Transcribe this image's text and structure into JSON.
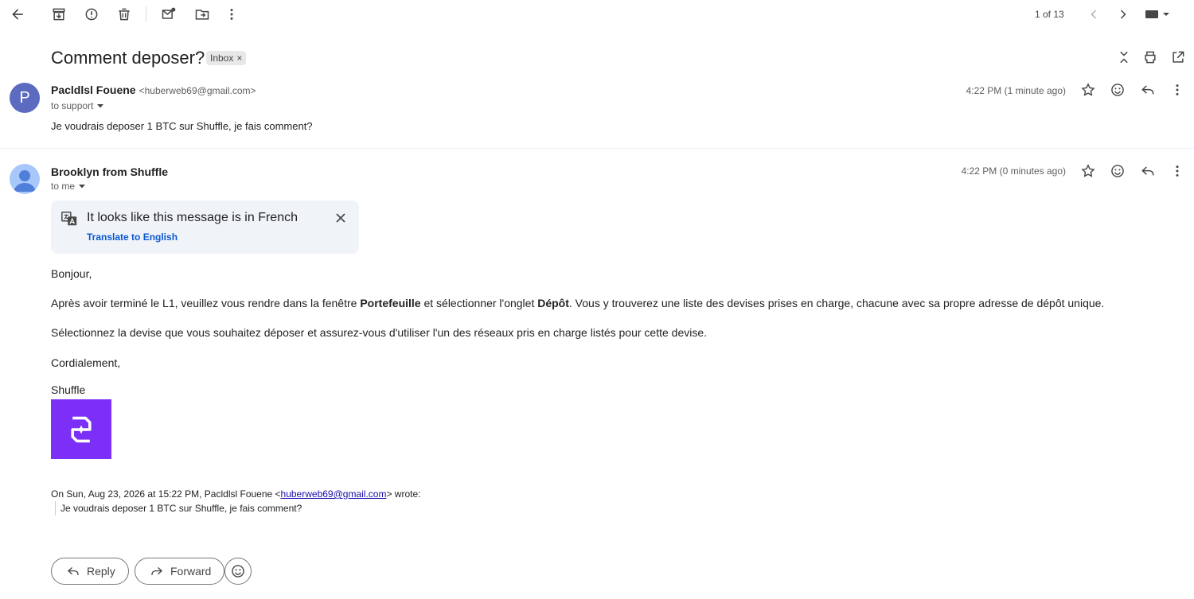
{
  "toolbar": {
    "pagination": "1 of 13"
  },
  "subject": {
    "title": "Comment deposer?",
    "label": "Inbox",
    "label_remove": "×"
  },
  "message1": {
    "avatar_letter": "P",
    "avatar_color": "#5c6bc0",
    "sender_name": "Pacldlsl Fouene",
    "sender_email": "<huberweb69@gmail.com>",
    "to": "to support",
    "time": "4:22 PM (1 minute ago)",
    "body": "Je voudrais deposer 1 BTC sur Shuffle, je fais comment?"
  },
  "message2": {
    "sender_name": "Brooklyn from Shuffle",
    "to": "to me",
    "time": "4:22 PM (0 minutes ago)",
    "translate": {
      "title": "It looks like this message is in French",
      "link": "Translate to English"
    },
    "greeting": "Bonjour,",
    "p1_a": "Après avoir terminé le L1, veuillez vous rendre dans la fenêtre ",
    "p1_b": "Portefeuille",
    "p1_c": " et sélectionner l'onglet ",
    "p1_d": "Dépôt",
    "p1_e": ". Vous y trouverez une liste des devises prises en charge, chacune avec sa propre adresse de dépôt unique.",
    "p2": "Sélectionnez la devise que vous souhaitez déposer et assurez-vous d'utiliser l'un des réseaux pris en charge listés pour cette devise.",
    "closing": "Cordialement,",
    "signature": "Shuffle",
    "logo_color": "#7b2ff7",
    "quote_header_a": "On Sun, Aug 23, 2026 at 15:22 PM, Pacldlsl Fouene <",
    "quote_header_link": "huberweb69@gmail.com",
    "quote_header_b": "> wrote:",
    "quote_body": "Je voudrais deposer 1 BTC sur Shuffle, je fais comment?"
  },
  "actions": {
    "reply": "Reply",
    "forward": "Forward"
  }
}
